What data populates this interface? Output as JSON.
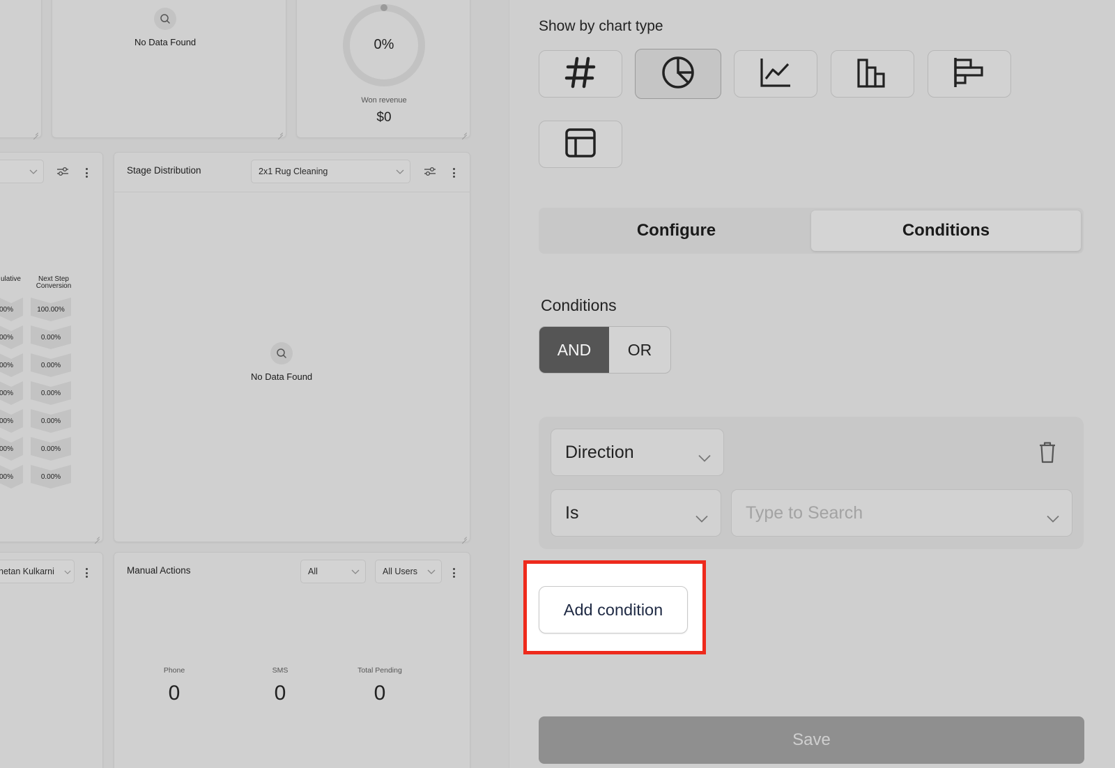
{
  "dashboard": {
    "top_card_middle": {
      "no_data": "No Data Found"
    },
    "won_revenue_card": {
      "percent": "0%",
      "label": "Won revenue",
      "value": "$0",
      "progress": 0
    },
    "funnel_card": {
      "col1_header": "ulative",
      "col2_header_line1": "Next Step",
      "col2_header_line2": "Conversion",
      "col1_values": [
        "00%",
        "00%",
        "00%",
        "00%",
        "00%",
        "00%",
        "00%"
      ],
      "col2_values": [
        "100.00%",
        "0.00%",
        "0.00%",
        "0.00%",
        "0.00%",
        "0.00%",
        "0.00%"
      ]
    },
    "stage_distribution": {
      "title": "Stage Distribution",
      "pipeline_select": "2x1 Rug Cleaning",
      "no_data": "No Data Found"
    },
    "user_select_partial": "hetan Kulkarni",
    "manual_actions": {
      "title": "Manual Actions",
      "filter_select": "All",
      "user_select": "All Users",
      "stats": [
        {
          "label": "Phone",
          "value": "0"
        },
        {
          "label": "SMS",
          "value": "0"
        },
        {
          "label": "Total Pending",
          "value": "0"
        }
      ]
    }
  },
  "drawer": {
    "chart_type_label": "Show by chart type",
    "chart_types": [
      "hash-icon",
      "pie-chart-icon",
      "line-chart-icon",
      "bar-chart-icon",
      "horizontal-bar-icon",
      "table-icon"
    ],
    "active_chart_type": "pie-chart-icon",
    "tabs": [
      {
        "label": "Configure"
      },
      {
        "label": "Conditions"
      }
    ],
    "active_tab": "Conditions",
    "conditions_label": "Conditions",
    "logic": {
      "and_label": "AND",
      "or_label": "OR",
      "selected": "AND"
    },
    "condition": {
      "field": "Direction",
      "operator": "Is",
      "value_placeholder": "Type to Search"
    },
    "add_condition_label": "Add condition",
    "save_label": "Save"
  },
  "colors": {
    "highlight": "#ee2a1c",
    "and_active": "#555555",
    "save_disabled": "#8f8f8f"
  }
}
